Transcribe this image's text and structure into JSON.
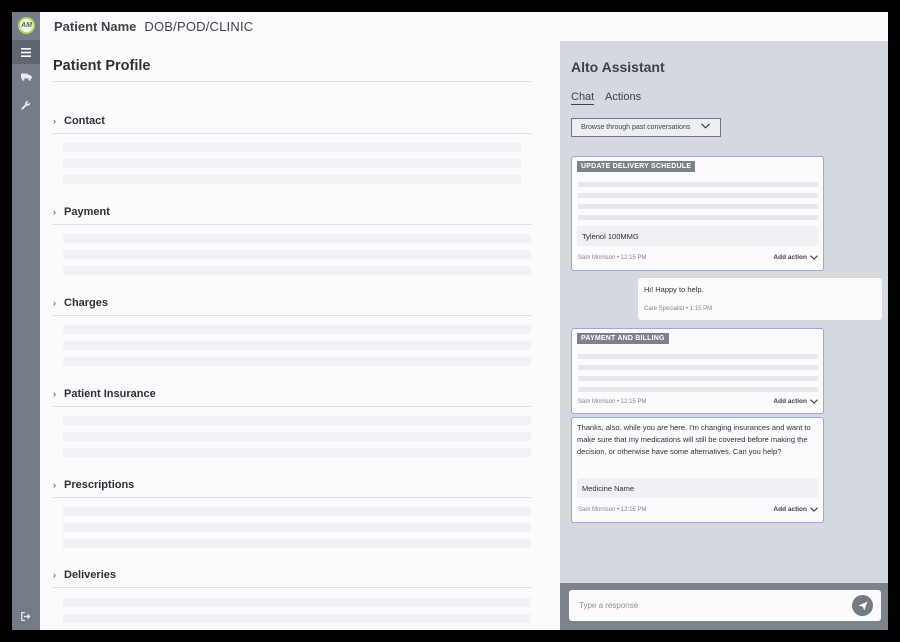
{
  "app": {
    "logo_text": "AM"
  },
  "sidebar": {
    "items": [
      {
        "name": "menu",
        "icon": "hamburger-icon"
      },
      {
        "name": "deliveries",
        "icon": "truck-icon"
      },
      {
        "name": "tools",
        "icon": "wrench-icon"
      },
      {
        "name": "logout",
        "icon": "logout-icon"
      }
    ]
  },
  "header": {
    "patient_name": "Patient Name",
    "dob_pod_clinic": "DOB/POD/CLINIC"
  },
  "profile": {
    "title": "Patient Profile",
    "sections": [
      {
        "label": "Contact"
      },
      {
        "label": "Payment"
      },
      {
        "label": "Charges"
      },
      {
        "label": "Patient Insurance"
      },
      {
        "label": "Prescriptions"
      },
      {
        "label": "Deliveries"
      }
    ]
  },
  "assistant": {
    "title": "Alto Assistant",
    "tabs": [
      {
        "label": "Chat",
        "active": true
      },
      {
        "label": "Actions",
        "active": false
      }
    ],
    "browse_label": "Browse through past conversations",
    "messages": [
      {
        "tag": "UPDATE DELIVERY SCHEDULE",
        "chip": "Tylenol 100MMG",
        "author": "Sam Morrison",
        "time": "12:15 PM",
        "action": "Add action"
      },
      {
        "text": "Hi! Happy to help.",
        "author": "Care Specialist",
        "time": "1:15 PM"
      },
      {
        "tag": "PAYMENT AND BILLING",
        "author": "Sam Morrison",
        "time": "12:15 PM",
        "action": "Add action"
      },
      {
        "text": "Thanks, also. while you are here. I'm changing insurances and want to make sure that my medications will still be covered before making the decision, or otherwise have some alternatives. Can you help?",
        "chip": "Medicine Name",
        "author": "Sam Morrison",
        "time": "12:15 PM",
        "action": "Add action"
      }
    ],
    "composer_placeholder": "Type a response"
  },
  "colors": {
    "sidebar": "#757c87",
    "assistant_bg": "#d4d9df",
    "card_border": "#9aa4e6",
    "tag_bg": "#7c828a",
    "logo_ring": "#b9d660"
  }
}
